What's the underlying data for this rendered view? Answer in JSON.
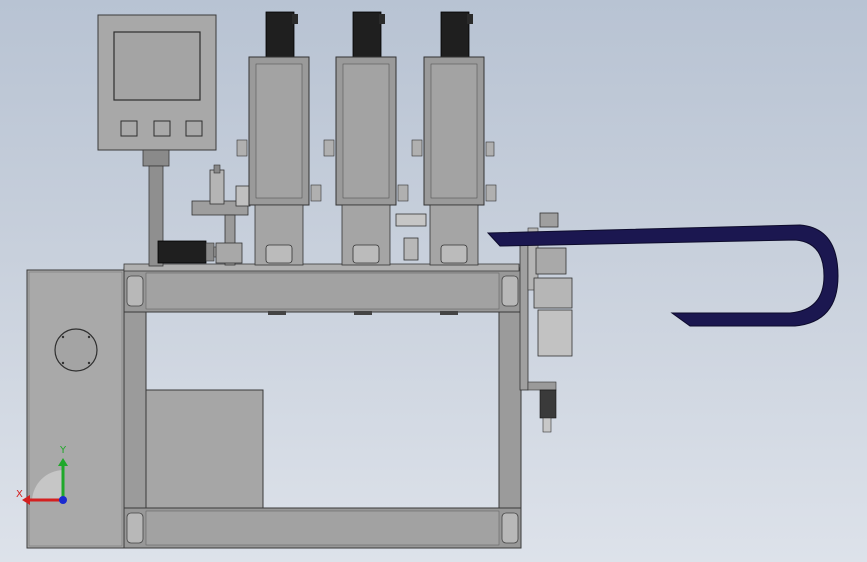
{
  "axis_triad": {
    "x_label": "X",
    "y_label": "Y",
    "x_color": "#d42020",
    "y_color": "#1fa82a",
    "z_color": "#1a2ad0"
  },
  "palette": {
    "frame": "#8e8e8e",
    "frame_dark": "#4a4a4a",
    "panel": "#a7a7a7",
    "hmi_screen": "#a0a0a0",
    "motor": "#222222",
    "cable_chain": "#1b1750",
    "module_body": "#9a9a9a"
  }
}
